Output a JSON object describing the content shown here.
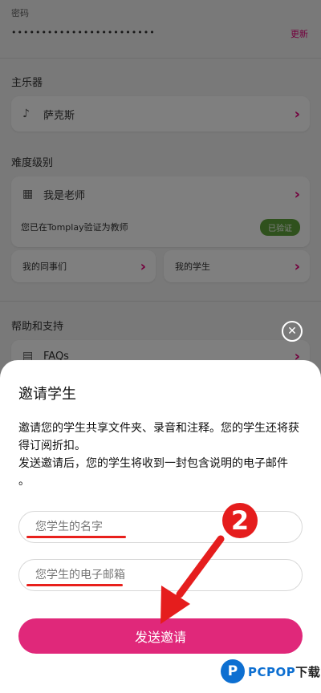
{
  "background": {
    "password_label": "密码",
    "password_value": "••••••••••••••••••••••••",
    "change_link": "更新",
    "instrument_section": "主乐器",
    "instrument_name": "萨克斯",
    "level_section": "难度级别",
    "teacher_label": "我是老师",
    "verify_text": "您已在Tomplay验证为教师",
    "verified_badge": "已验证",
    "colleagues_label": "我的同事们",
    "students_label": "我的学生",
    "help_section": "帮助和支持",
    "faq_label": "FAQs"
  },
  "dialog": {
    "close_symbol": "✕",
    "title": "邀请学生",
    "description_line1": "邀请您的学生共享文件夹、录音和注释。您的学生还将获得订阅折扣。",
    "description_line2": "发送邀请后，您的学生将收到一封包含说明的电子邮件",
    "description_line3": "。",
    "name_placeholder": "您学生的名字",
    "email_placeholder": "您学生的电子邮箱",
    "send_button": "发送邀请"
  },
  "annotation": {
    "step_number": "2"
  },
  "watermark": {
    "logo_letter": "P",
    "brand": "PCPOP",
    "suffix": "下载"
  },
  "colors": {
    "accent": "#e0287a",
    "annotation_red": "#e51d1d",
    "verified_green": "#5fa33a"
  }
}
